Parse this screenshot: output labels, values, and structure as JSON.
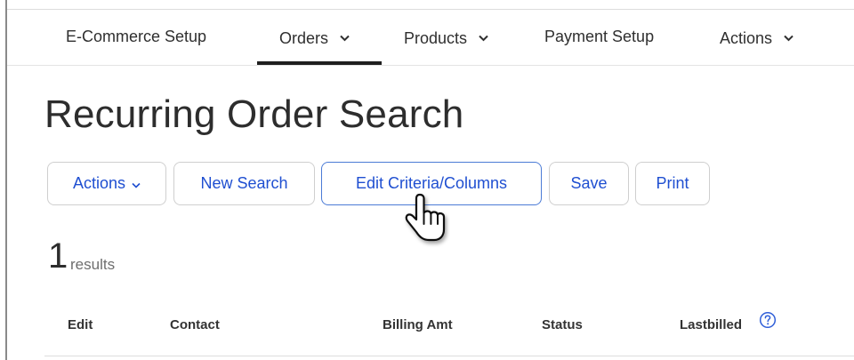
{
  "nav": {
    "items": [
      {
        "label": "E-Commerce Setup"
      },
      {
        "label": "Orders",
        "has_dropdown": true,
        "active": true
      },
      {
        "label": "Products",
        "has_dropdown": true
      },
      {
        "label": "Payment Setup"
      },
      {
        "label": "Actions",
        "has_dropdown": true
      }
    ]
  },
  "page": {
    "title": "Recurring Order Search"
  },
  "toolbar": {
    "actions_label": "Actions",
    "new_search_label": "New Search",
    "edit_criteria_label": "Edit Criteria/Columns",
    "save_label": "Save",
    "print_label": "Print"
  },
  "results": {
    "count": "1",
    "label": "results"
  },
  "table": {
    "columns": [
      "Edit",
      "Contact",
      "Billing Amt",
      "Status",
      "Lastbilled"
    ]
  },
  "colors": {
    "link_blue": "#1f4fd1",
    "active_border": "#4b7bd6",
    "nav_underline": "#1f1f1f"
  },
  "icons": {
    "dropdown": "chevron-down-icon",
    "help": "help-icon",
    "cursor": "hand-pointer-icon"
  }
}
